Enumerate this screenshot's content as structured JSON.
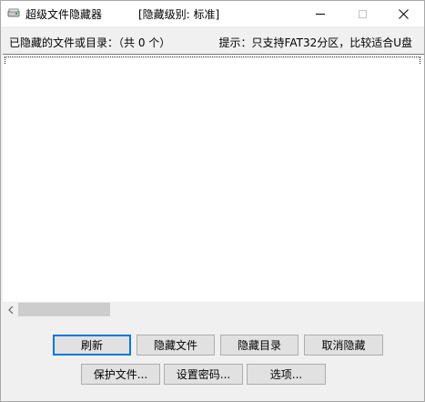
{
  "window": {
    "title": "超级文件隐藏器",
    "level_label": "[隐藏级别: 标准]"
  },
  "info": {
    "count_label": "已隐藏的文件或目录：（共 0 个）",
    "hint": "提示：只支持FAT32分区，比较适合U盘"
  },
  "buttons": {
    "refresh": "刷新",
    "hide_file": "隐藏文件",
    "hide_dir": "隐藏目录",
    "unhide": "取消隐藏",
    "protect_file": "保护文件...",
    "set_password": "设置密码...",
    "options": "选项..."
  },
  "icons": {
    "app": "app-drive-icon",
    "minimize": "minimize-icon",
    "maximize": "maximize-icon",
    "close": "close-icon",
    "scroll_left": "scroll-left-arrow-icon"
  }
}
